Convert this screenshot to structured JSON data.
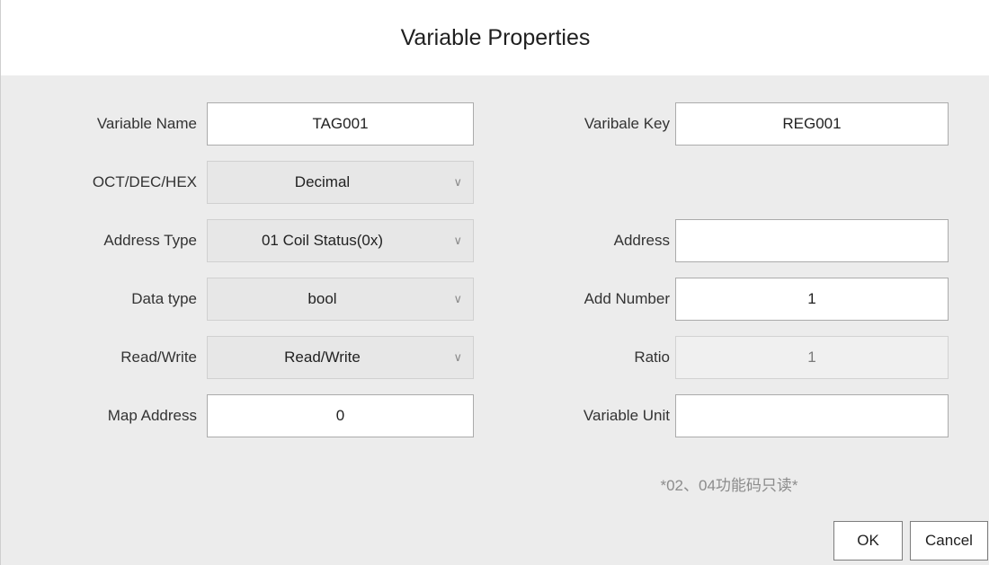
{
  "dialog": {
    "title": "Variable Properties"
  },
  "fields": {
    "variable_name": {
      "label": "Variable Name",
      "value": "TAG001"
    },
    "variable_key": {
      "label": "Varibale Key",
      "value": "REG001"
    },
    "number_format": {
      "label": "OCT/DEC/HEX",
      "selected": "Decimal"
    },
    "address_type": {
      "label": "Address Type",
      "selected": "01 Coil Status(0x)"
    },
    "address": {
      "label": "Address",
      "value": ""
    },
    "data_type": {
      "label": "Data type",
      "selected": "bool"
    },
    "add_number": {
      "label": "Add Number",
      "value": "1"
    },
    "read_write": {
      "label": "Read/Write",
      "selected": "Read/Write"
    },
    "ratio": {
      "label": "Ratio",
      "value": "1"
    },
    "map_address": {
      "label": "Map Address",
      "value": "0"
    },
    "variable_unit": {
      "label": "Variable Unit",
      "value": ""
    }
  },
  "note": "*02、04功能码只读*",
  "buttons": {
    "ok": "OK",
    "cancel": "Cancel"
  },
  "icons": {
    "dropdown": "chevron-down-icon"
  },
  "colors": {
    "dialog_background": "#ececec",
    "title_background": "#ffffff",
    "input_border": "#ababab",
    "disabled_background": "#f0f0f0",
    "note_text": "#8c8c8c"
  }
}
